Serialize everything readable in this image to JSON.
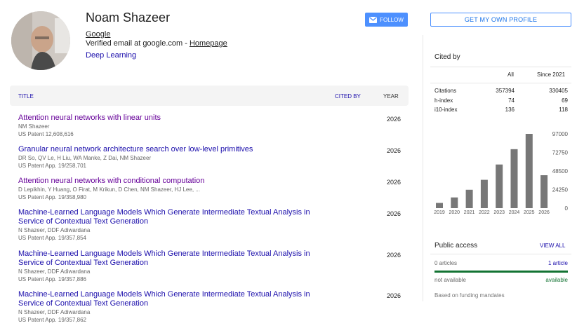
{
  "profile": {
    "name": "Noam Shazeer",
    "affiliation": "Google",
    "email_text": "Verified email at google.com - ",
    "homepage_label": "Homepage",
    "interest": "Deep Learning"
  },
  "buttons": {
    "follow_label": "FOLLOW",
    "own_profile_label": "GET MY OWN PROFILE"
  },
  "table": {
    "col_title": "TITLE",
    "col_cited": "CITED BY",
    "col_year": "YEAR",
    "articles": [
      {
        "title": "Attention neural networks with linear units",
        "authors": "NM Shazeer",
        "venue": "US Patent 12,608,616",
        "year": "2026",
        "visited": true
      },
      {
        "title": "Granular neural network architecture search over low-level primitives",
        "authors": "DR So, QV Le, H Liu, WA Manke, Z Dai, NM Shazeer",
        "venue": "US Patent App. 19/258,701",
        "year": "2026",
        "visited": false
      },
      {
        "title": "Attention neural networks with conditional computation",
        "authors": "D Lepikhin, Y Huang, O Firat, M Krikun, D Chen, NM Shazeer, HJ Lee, ...",
        "venue": "US Patent App. 19/358,980",
        "year": "2026",
        "visited": true
      },
      {
        "title": "Machine-Learned Language Models Which Generate Intermediate Textual Analysis in Service of Contextual Text Generation",
        "authors": "N Shazeer, DDF Adiwardana",
        "venue": "US Patent App. 19/357,854",
        "year": "2026",
        "visited": false
      },
      {
        "title": "Machine-Learned Language Models Which Generate Intermediate Textual Analysis in Service of Contextual Text Generation",
        "authors": "N Shazeer, DDF Adiwardana",
        "venue": "US Patent App. 19/357,886",
        "year": "2026",
        "visited": false
      },
      {
        "title": "Machine-Learned Language Models Which Generate Intermediate Textual Analysis in Service of Contextual Text Generation",
        "authors": "N Shazeer, DDF Adiwardana",
        "venue": "US Patent App. 19/357,862",
        "year": "2026",
        "visited": false
      }
    ]
  },
  "cited_by": {
    "title": "Cited by",
    "col_all": "All",
    "col_since": "Since 2021",
    "rows": [
      {
        "label": "Citations",
        "all": "357394",
        "since": "330405"
      },
      {
        "label": "h-index",
        "all": "74",
        "since": "69"
      },
      {
        "label": "i10-index",
        "all": "136",
        "since": "118"
      }
    ]
  },
  "chart_data": {
    "type": "bar",
    "categories": [
      "2019",
      "2020",
      "2021",
      "2022",
      "2023",
      "2024",
      "2025",
      "2026"
    ],
    "values": [
      6800,
      14000,
      24000,
      37000,
      57000,
      77000,
      97000,
      43000
    ],
    "yticks": [
      "97000",
      "72750",
      "48500",
      "24250",
      "0"
    ],
    "ylim": [
      0,
      97000
    ],
    "bar_color": "#777777"
  },
  "public_access": {
    "title": "Public access",
    "view_all": "VIEW ALL",
    "left_count": "0 articles",
    "right_count": "1 article",
    "left_status": "not available",
    "right_status": "available",
    "funding_note": "Based on funding mandates",
    "available_color": "#137333"
  }
}
